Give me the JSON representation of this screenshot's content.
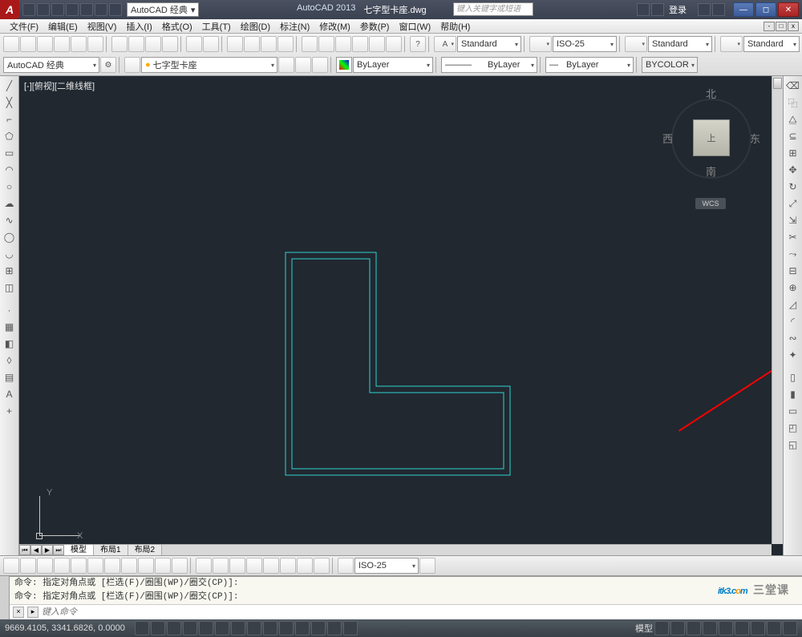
{
  "title": {
    "workspace": "AutoCAD 经典",
    "app": "AutoCAD 2013",
    "file": "七字型卡座.dwg",
    "search_ph": "键入关键字或短语",
    "login": "登录"
  },
  "menu": [
    "文件(F)",
    "编辑(E)",
    "视图(V)",
    "插入(I)",
    "格式(O)",
    "工具(T)",
    "绘图(D)",
    "标注(N)",
    "修改(M)",
    "参数(P)",
    "窗口(W)",
    "帮助(H)"
  ],
  "row1": {
    "style_text": "Standard",
    "dim_style": "ISO-25",
    "table_style": "Standard",
    "ml_style": "Standard"
  },
  "row2": {
    "workspace": "AutoCAD 经典",
    "layer": "七字型卡座",
    "color": "ByLayer",
    "linetype": "ByLayer",
    "lineweight": "ByLayer",
    "plotstyle": "BYCOLOR"
  },
  "view": {
    "label": "[-][俯视][二维线框]",
    "cube_face": "上",
    "dir_n": "北",
    "dir_e": "东",
    "dir_s": "南",
    "dir_w": "西",
    "wcs": "WCS",
    "ucs_x": "X",
    "ucs_y": "Y"
  },
  "tabs": {
    "model": "模型",
    "l1": "布局1",
    "l2": "布局2"
  },
  "dim_combo": "ISO-25",
  "cmd": {
    "hist1": "命令: 指定对角点或 [栏选(F)/圈围(WP)/圈交(CP)]:",
    "hist2": "命令: 指定对角点或 [栏选(F)/圈围(WP)/圈交(CP)]:",
    "ph": "键入命令"
  },
  "status": {
    "coords": "9669.4105, 3341.6826, 0.0000",
    "model": "模型"
  },
  "watermark": {
    "prefix": "itk3",
    "mid": ".c",
    "o": "o",
    "suffix": "m",
    "sub": "三堂课"
  }
}
